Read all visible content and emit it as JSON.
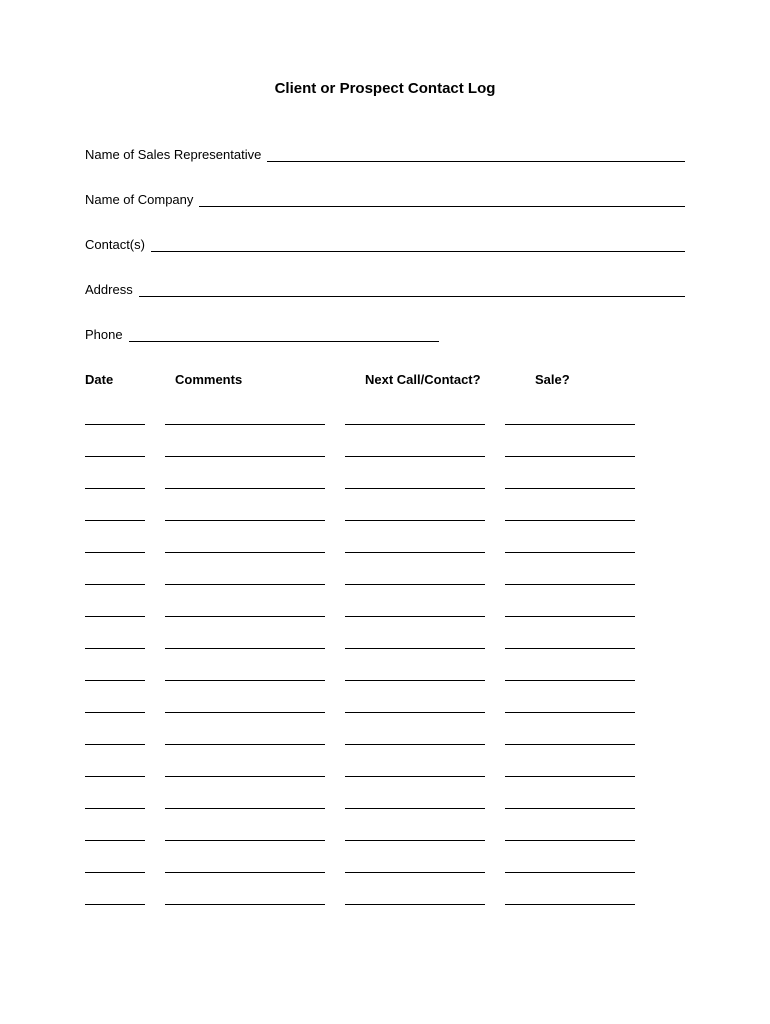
{
  "title": "Client or Prospect Contact Log",
  "fields": {
    "sales_rep": "Name of Sales Representative",
    "company": "Name of Company",
    "contacts": "Contact(s)",
    "address": "Address",
    "phone": "Phone"
  },
  "table": {
    "headers": {
      "date": "Date",
      "comments": "Comments",
      "next": "Next Call/Contact?",
      "sale": "Sale?"
    },
    "row_count": 16
  }
}
